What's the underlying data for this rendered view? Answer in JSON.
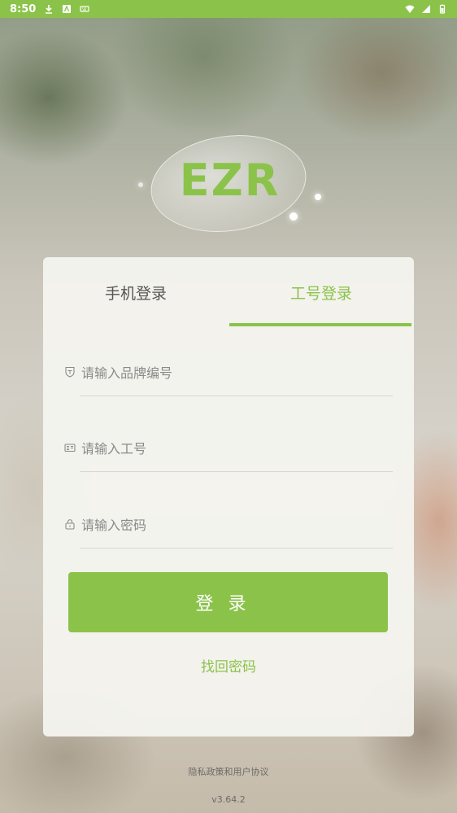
{
  "status_bar": {
    "time": "8:50",
    "background": "#8bc34a"
  },
  "logo": {
    "text": "EZR",
    "color": "#8bc34a"
  },
  "tabs": [
    {
      "label": "手机登录",
      "active": false
    },
    {
      "label": "工号登录",
      "active": true
    }
  ],
  "fields": {
    "brand": {
      "placeholder": "请输入品牌编号",
      "value": "",
      "icon": "brand-shield-icon"
    },
    "employee_id": {
      "placeholder": "请输入工号",
      "value": "",
      "icon": "id-card-icon"
    },
    "password": {
      "placeholder": "请输入密码",
      "value": "",
      "icon": "lock-icon"
    }
  },
  "login_button": {
    "label": "登录"
  },
  "forgot_password": {
    "label": "找回密码"
  },
  "footer": {
    "privacy_label": "隐私政策和用户协议",
    "version": "v3.64.2"
  },
  "accent_color": "#8bc34a"
}
